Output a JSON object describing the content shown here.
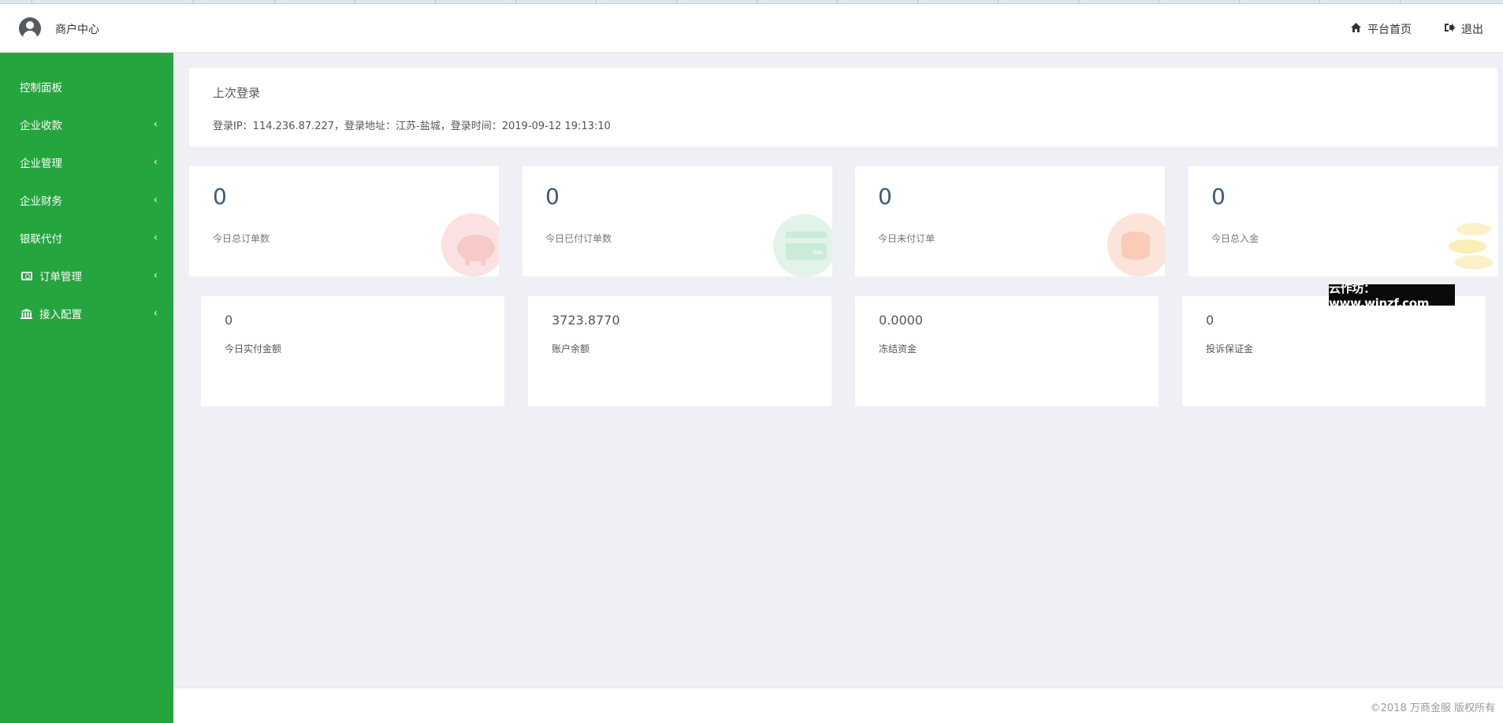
{
  "header": {
    "brand": "商户中心",
    "home_link": "平台首页",
    "logout_link": "退出"
  },
  "sidebar": {
    "items": [
      {
        "label": "控制面板",
        "icon": "none",
        "has_chevron": false
      },
      {
        "label": "企业收款",
        "icon": "none",
        "has_chevron": true
      },
      {
        "label": "企业管理",
        "icon": "none",
        "has_chevron": true
      },
      {
        "label": "企业财务",
        "icon": "none",
        "has_chevron": true
      },
      {
        "label": "银联代付",
        "icon": "none",
        "has_chevron": true
      },
      {
        "label": "订单管理",
        "icon": "cash-icon",
        "has_chevron": true
      },
      {
        "label": "接入配置",
        "icon": "bank-icon",
        "has_chevron": true
      }
    ],
    "color": "#24a53d"
  },
  "last_login": {
    "title": "上次登录",
    "info": "登录IP：114.236.87.227，登录地址：江苏-盐城，登录时间：2019-09-12 19:13:10"
  },
  "stats": [
    {
      "value": "0",
      "label": "今日总订单数",
      "icon": "piggy-bank-icon",
      "icon_color": "#f6c2c2"
    },
    {
      "value": "0",
      "label": "今日已付订单数",
      "icon": "credit-card-icon",
      "icon_color": "#c4ead6"
    },
    {
      "value": "0",
      "label": "今日未付订单",
      "icon": "coin-stack-icon",
      "icon_color": "#f8d2c2"
    },
    {
      "value": "0",
      "label": "今日总入金",
      "icon": "coins-icon",
      "icon_color": "#faeeb8"
    }
  ],
  "balances": [
    {
      "value": "0",
      "label": "今日实付金额"
    },
    {
      "value": "3723.8770",
      "label": "账户余额"
    },
    {
      "value": "0.0000",
      "label": "冻结资金"
    },
    {
      "value": "0",
      "label": "投诉保证金"
    }
  ],
  "watermark": "云作坊：www.winzf.com",
  "footer": "©2018 万商金服 版权所有"
}
